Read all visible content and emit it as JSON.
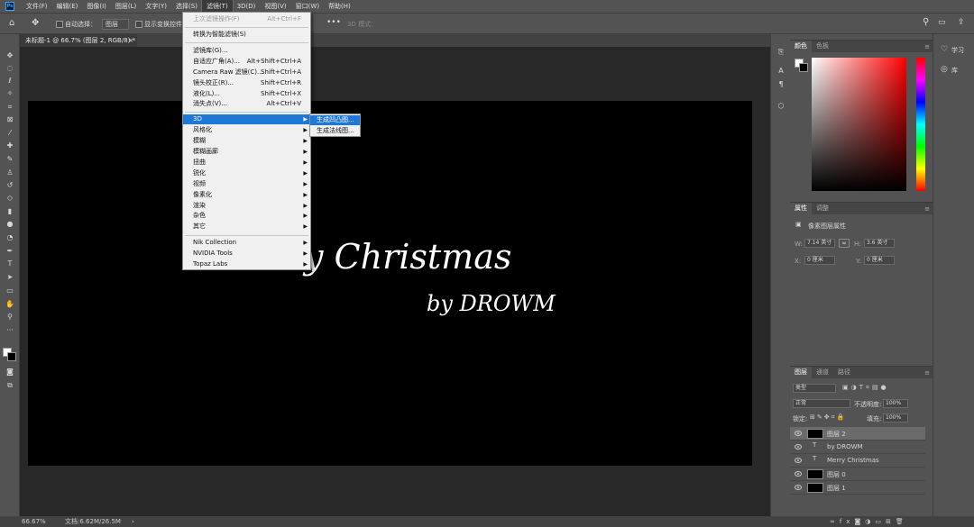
{
  "menubar": {
    "items": [
      "文件(F)",
      "编辑(E)",
      "图像(I)",
      "图层(L)",
      "文字(Y)",
      "选择(S)",
      "滤镜(T)",
      "3D(D)",
      "视图(V)",
      "窗口(W)",
      "帮助(H)"
    ],
    "active_index": 6
  },
  "options": {
    "auto_select_label": "自动选择：",
    "auto_select_value": "图层",
    "show_transform_label": "显示变换控件",
    "mode_3d": "3D 模式："
  },
  "document": {
    "tab_title": "未标题-1 @ 66.7% (图层 2, RGB/8) *",
    "title_text": "y Christmas",
    "byline_text": "by DROWM"
  },
  "status": {
    "zoom": "66.67%",
    "doc_info": "文档:6.62M/26.5M"
  },
  "filter_menu": {
    "items": [
      {
        "label": "上次滤镜操作(F)",
        "shortcut": "Alt+Ctrl+F",
        "disabled": true
      },
      {
        "label": "转换为智能滤镜(S)",
        "shortcut": ""
      },
      {
        "label": "滤镜库(G)...",
        "shortcut": ""
      },
      {
        "label": "自适应广角(A)...",
        "shortcut": "Alt+Shift+Ctrl+A"
      },
      {
        "label": "Camera Raw 滤镜(C)...",
        "shortcut": "Shift+Ctrl+A"
      },
      {
        "label": "镜头校正(R)...",
        "shortcut": "Shift+Ctrl+R"
      },
      {
        "label": "液化(L)...",
        "shortcut": "Shift+Ctrl+X"
      },
      {
        "label": "消失点(V)...",
        "shortcut": "Alt+Ctrl+V"
      },
      {
        "label": "3D",
        "submenu": true,
        "highlighted": true
      },
      {
        "label": "风格化",
        "submenu": true
      },
      {
        "label": "模糊",
        "submenu": true
      },
      {
        "label": "模糊画廊",
        "submenu": true
      },
      {
        "label": "扭曲",
        "submenu": true
      },
      {
        "label": "锐化",
        "submenu": true
      },
      {
        "label": "视频",
        "submenu": true
      },
      {
        "label": "像素化",
        "submenu": true
      },
      {
        "label": "渲染",
        "submenu": true
      },
      {
        "label": "杂色",
        "submenu": true
      },
      {
        "label": "其它",
        "submenu": true
      },
      {
        "label": "Nik Collection",
        "submenu": true
      },
      {
        "label": "NVIDIA Tools",
        "submenu": true
      },
      {
        "label": "Topaz Labs",
        "submenu": true
      }
    ],
    "submenu_3d": [
      "生成凹凸图...",
      "生成法线图..."
    ]
  },
  "color_panel": {
    "tabs": [
      "颜色",
      "色板"
    ],
    "hue_color": "#ff0000"
  },
  "properties_panel": {
    "tabs": [
      "属性",
      "调整"
    ],
    "section": "像素图层属性",
    "w_label": "W:",
    "w_value": "7.14 英寸",
    "h_label": "H:",
    "h_value": "3.6 英寸",
    "x_label": "X:",
    "x_value": "0 厘米",
    "y_label": "Y:",
    "y_value": "0 厘米"
  },
  "layers_panel": {
    "tabs": [
      "图层",
      "通道",
      "路径"
    ],
    "kind": "类型",
    "blend_mode": "正常",
    "opacity_label": "不透明度:",
    "opacity_value": "100%",
    "lock_label": "锁定:",
    "fill_label": "填充:",
    "fill_value": "100%",
    "layers": [
      {
        "name": "图层 2",
        "type": "pixel",
        "selected": true
      },
      {
        "name": "by DROWM",
        "type": "text"
      },
      {
        "name": "Merry  Christmas",
        "type": "text"
      },
      {
        "name": "图层 0",
        "type": "pixel"
      },
      {
        "name": "图层 1",
        "type": "pixel"
      }
    ]
  },
  "right_strip": {
    "learn": "学习",
    "library": "库"
  }
}
